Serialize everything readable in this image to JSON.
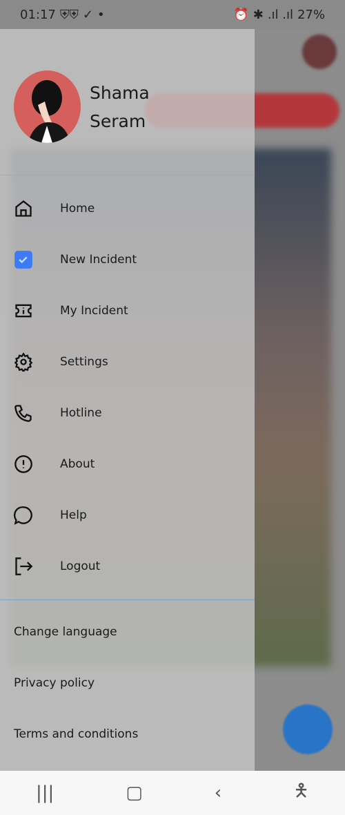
{
  "status_bar": {
    "time": "01:17",
    "battery": "27%",
    "icons": [
      "shield-icon",
      "shield-icon",
      "download-done-icon",
      "dot-icon",
      "battery-saver-icon",
      "alarm-icon",
      "bluetooth-icon",
      "wifi-icon",
      "signal-icon",
      "signal-icon",
      "battery-icon"
    ]
  },
  "drawer": {
    "user": {
      "first_name": "Shama",
      "last_name": "Seram"
    },
    "items": [
      {
        "label": "Home",
        "icon": "home-icon"
      },
      {
        "label": "New Incident",
        "icon": "checkbox-icon"
      },
      {
        "label": "My Incident",
        "icon": "ticket-icon"
      },
      {
        "label": "Settings",
        "icon": "gear-icon"
      },
      {
        "label": "Hotline",
        "icon": "phone-icon"
      },
      {
        "label": "About",
        "icon": "info-icon"
      },
      {
        "label": "Help",
        "icon": "chat-icon"
      },
      {
        "label": "Logout",
        "icon": "logout-icon"
      }
    ],
    "links": [
      "Change language",
      "Privacy policy",
      "Terms and conditions"
    ],
    "accent": "#3d7bf5"
  },
  "nav_bar": {
    "icons": [
      "recent-apps-icon",
      "home-icon",
      "back-icon",
      "accessibility-icon"
    ]
  }
}
